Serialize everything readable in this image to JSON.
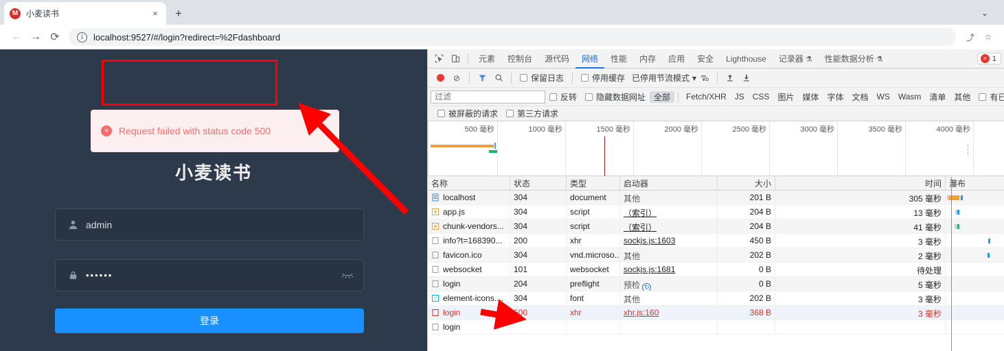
{
  "browser": {
    "tab": {
      "title": "小麦读书",
      "favicon_letter": "M",
      "close_label": "×"
    },
    "new_tab_label": "+",
    "window_chevron": "⌄",
    "back_label": "←",
    "forward_label": "→",
    "reload_label": "⟳",
    "info_label": "ⓘ",
    "url": "localhost:9527/#/login?redirect=%2Fdashboard",
    "share_label": "⤴",
    "bookmark_label": "☆"
  },
  "toast": {
    "icon": "×",
    "message": "Request failed with status code 500"
  },
  "login": {
    "title": "小麦读书",
    "username": "admin",
    "password_dots": "••••••",
    "submit_label": "登录"
  },
  "devtools": {
    "tabs": [
      {
        "label": "元素",
        "active": false
      },
      {
        "label": "控制台",
        "active": false
      },
      {
        "label": "源代码",
        "active": false
      },
      {
        "label": "网络",
        "active": true
      },
      {
        "label": "性能",
        "active": false
      },
      {
        "label": "内存",
        "active": false
      },
      {
        "label": "应用",
        "active": false
      },
      {
        "label": "安全",
        "active": false
      },
      {
        "label": "Lighthouse",
        "active": false
      },
      {
        "label": "记录器",
        "active": false,
        "flask": "⚗"
      },
      {
        "label": "性能数据分析",
        "active": false,
        "flask": "⚗"
      }
    ],
    "error_badge": {
      "icon": "×",
      "count": "1"
    },
    "toolbar": {
      "record_title": "record",
      "clear_label": "⊘",
      "filter_label": "▽",
      "search_label": "🔍",
      "preserve_log": "保留日志",
      "disable_cache": "停用缓存",
      "throttling": "已停用节流模式",
      "dropdown": "▾",
      "wifi_label": "((·))",
      "import_label": "↑",
      "export_label": "↓"
    },
    "filterbar": {
      "filter_placeholder": "过滤",
      "invert": "反转",
      "hide_data_urls": "隐藏数据网址",
      "types": [
        "全部",
        "Fetch/XHR",
        "JS",
        "CSS",
        "图片",
        "媒体",
        "字体",
        "文档",
        "WS",
        "Wasm",
        "清单",
        "其他"
      ],
      "selected_type": "全部",
      "blocked_label": "有已拦截的"
    },
    "filterbar2": {
      "blocked_requests": "被屏蔽的请求",
      "third_party": "第三方请求"
    },
    "overview": {
      "ticks": [
        "500 毫秒",
        "1000 毫秒",
        "1500 毫秒",
        "2000 毫秒",
        "2500 毫秒",
        "3000 毫秒",
        "3500 毫秒",
        "4000 毫秒"
      ]
    },
    "table": {
      "columns": [
        "名称",
        "状态",
        "类型",
        "启动器",
        "大小",
        "时间",
        "瀑布"
      ],
      "rows": [
        {
          "name": "localhost",
          "status": "304",
          "type": "document",
          "initiator": "其他",
          "initiator_link": false,
          "size": "201 B",
          "time": "305 毫秒",
          "icon": "document-icon",
          "error": false
        },
        {
          "name": "app.js",
          "status": "304",
          "type": "script",
          "initiator": "（索引）",
          "initiator_link": true,
          "size": "204 B",
          "time": "13 毫秒",
          "icon": "script-icon",
          "error": false
        },
        {
          "name": "chunk-vendors...",
          "status": "304",
          "type": "script",
          "initiator": "（索引）",
          "initiator_link": true,
          "size": "204 B",
          "time": "41 毫秒",
          "icon": "script-icon",
          "error": false
        },
        {
          "name": "info?t=168390...",
          "status": "200",
          "type": "xhr",
          "initiator": "sockjs.js:1603",
          "initiator_link": true,
          "size": "450 B",
          "time": "3 毫秒",
          "icon": "generic-icon",
          "error": false
        },
        {
          "name": "favicon.ico",
          "status": "304",
          "type": "vnd.microso...",
          "initiator": "其他",
          "initiator_link": false,
          "size": "202 B",
          "time": "2 毫秒",
          "icon": "generic-icon",
          "error": false
        },
        {
          "name": "websocket",
          "status": "101",
          "type": "websocket",
          "initiator": "sockjs.js:1681",
          "initiator_link": true,
          "size": "0 B",
          "time": "待处理",
          "icon": "generic-icon",
          "error": false
        },
        {
          "name": "login",
          "status": "204",
          "type": "preflight",
          "initiator": "预检",
          "initiator_link": false,
          "size": "0 B",
          "time": "5 毫秒",
          "icon": "generic-icon",
          "error": false,
          "initiator_badge": "↻"
        },
        {
          "name": "element-icons....",
          "status": "304",
          "type": "font",
          "initiator": "其他",
          "initiator_link": false,
          "size": "202 B",
          "time": "3 毫秒",
          "icon": "font-icon",
          "error": false
        },
        {
          "name": "login",
          "status": "500",
          "type": "xhr",
          "initiator": "xhr.js:160",
          "initiator_link": true,
          "size": "368 B",
          "time": "3 毫秒",
          "icon": "error-icon",
          "error": true
        },
        {
          "name": "login",
          "status": "",
          "type": "",
          "initiator": "",
          "initiator_link": false,
          "size": "",
          "time": "",
          "icon": "generic-icon",
          "error": false
        }
      ]
    }
  },
  "colors": {
    "accent_blue": "#1890ff",
    "error_red": "#f56c6c",
    "annotation_red": "#ff0000",
    "devtools_link_blue": "#1a73e8",
    "page_bg": "#2d3a4b"
  }
}
